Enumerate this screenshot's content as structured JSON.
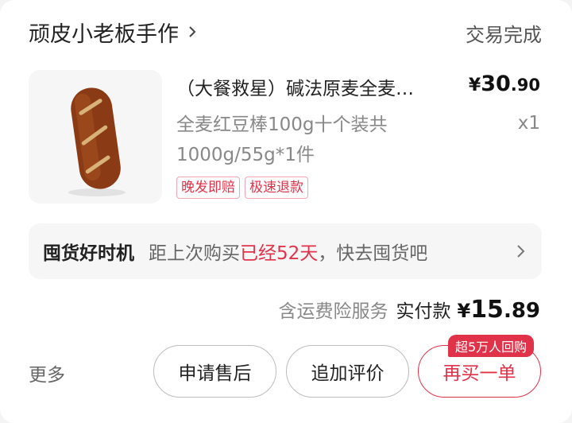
{
  "store": {
    "name": "顽皮小老板手作",
    "status": "交易完成"
  },
  "product": {
    "image_icon": "bread-roll-image",
    "title": "（大餐救星）碱法原麦全麦…",
    "price": {
      "currency": "¥",
      "integer": "30",
      "decimal": ".90"
    },
    "spec_line1": "全麦红豆棒100g十个装共",
    "spec_line2": "1000g/55g*1件",
    "quantity": "x1",
    "tags": [
      "晚发即赔",
      "极速退款"
    ]
  },
  "promo": {
    "title": "囤货好时机",
    "text_before": "距上次购买",
    "highlight": "已经52天",
    "text_after": "，快去囤货吧"
  },
  "summary": {
    "note": "含运费险服务",
    "label": "实付款",
    "currency": "¥",
    "integer": "15",
    "decimal": ".89"
  },
  "actions": {
    "more": "更多",
    "after_sale": "申请售后",
    "add_review": "追加评价",
    "buy_again": "再买一单",
    "buy_again_badge": "超5万人回购"
  },
  "colors": {
    "accent": "#e0334a",
    "card_bg": "#ffffff",
    "muted_bg": "#f6f6f6"
  }
}
